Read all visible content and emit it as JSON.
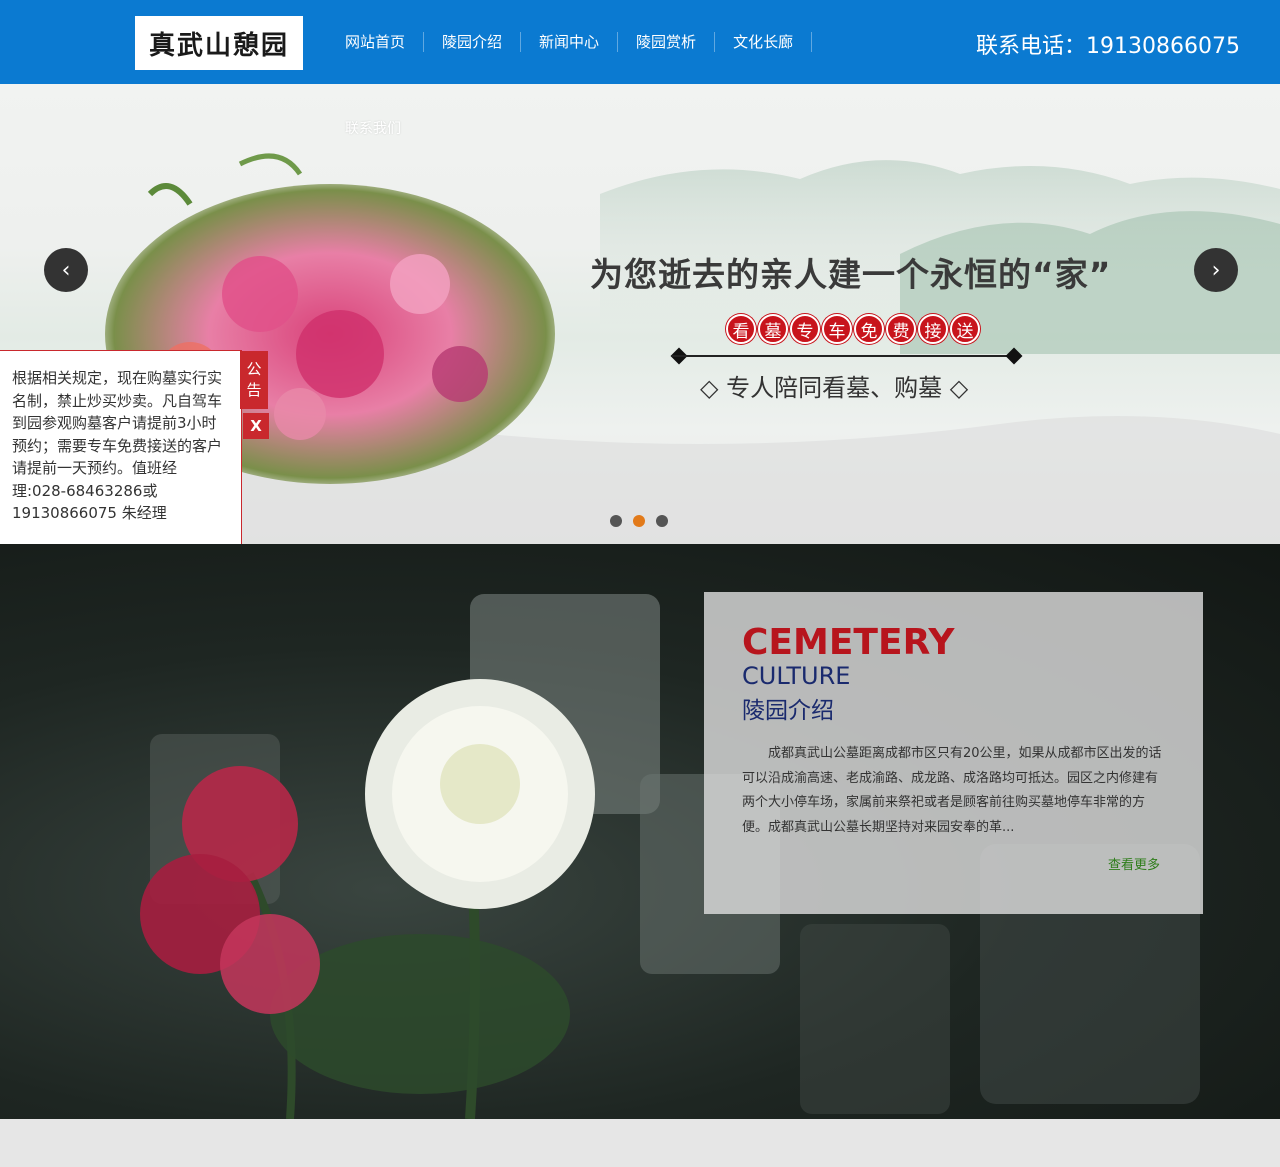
{
  "header": {
    "logo_text": "真武山憩园",
    "nav": [
      "网站首页",
      "陵园介绍",
      "新闻中心",
      "陵园赏析",
      "文化长廊"
    ],
    "phone": "联系电话：19130866075"
  },
  "banner": {
    "contact_link": "联系我们",
    "headline": "为您逝去的亲人建一个永恒的“家”",
    "circles": [
      "看",
      "墓",
      "专",
      "车",
      "免",
      "费",
      "接",
      "送"
    ],
    "subline": "◇ 专人陪同看墓、购墓 ◇",
    "prev_icon": "chevron-left-icon",
    "next_icon": "chevron-right-icon",
    "prev_glyph": "‹",
    "next_glyph": "›",
    "active_dot": 2,
    "dot_count": 3
  },
  "notice": {
    "text": "根据相关规定，现在购墓实行实名制，禁止炒买炒卖。凡自驾车到园参观购墓客户请提前3小时预约；需要专车免费接送的客户请提前一天预约。值班经理:028-68463286或19130866075 朱经理",
    "tab_label": "公告",
    "close_label": "X"
  },
  "intro": {
    "en_title_1": "CEMETERY",
    "en_title_2": "CULTURE",
    "cn_title": "陵园介绍",
    "body": "成都真武山公墓距离成都市区只有20公里，如果从成都市区出发的话可以沿成渝高速、老成渝路、成龙路、成洛路均可抵达。园区之内修建有两个大小停车场，家属前来祭祀或者是顾客前往购买墓地停车非常的方便。成都真武山公墓长期坚持对来园安奉的革...",
    "more_link": "查看更多"
  },
  "colors": {
    "header_bg": "#0b7ad1",
    "accent_red": "#c8141c",
    "title_blue": "#1a2a6e",
    "more_green": "#2e7d1a",
    "dot_active": "#e27a1a"
  }
}
